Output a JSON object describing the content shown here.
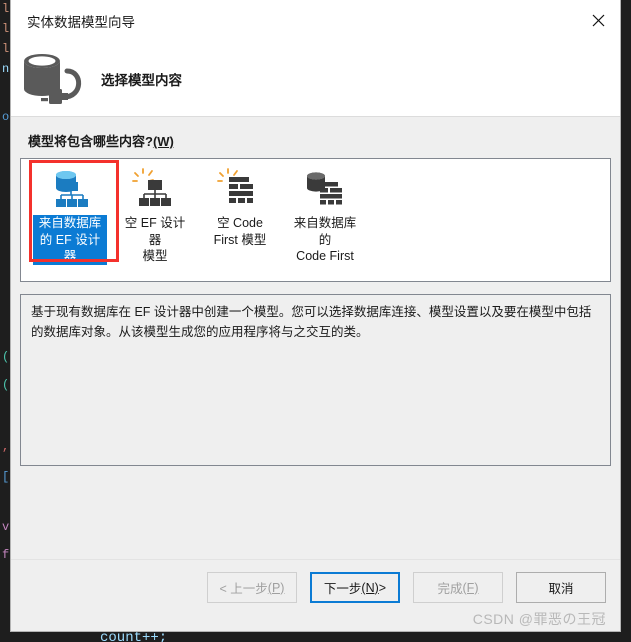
{
  "window": {
    "title": "实体数据模型向导",
    "close_label": "✕"
  },
  "header": {
    "icon": "database-plug-icon",
    "title": "选择模型内容"
  },
  "main": {
    "question": "模型将包含哪些内容?",
    "question_accel": "(W)",
    "models": [
      {
        "label": "来自数据库\n的 EF 设计器",
        "icon": "database-ef-designer-icon",
        "selected": true,
        "annotated": true
      },
      {
        "label": "空 EF 设计器\n模型",
        "icon": "empty-ef-designer-icon",
        "selected": false,
        "annotated": false
      },
      {
        "label": "空 Code\nFirst 模型",
        "icon": "empty-code-first-icon",
        "selected": false,
        "annotated": false
      },
      {
        "label": "来自数据库的\nCode First",
        "icon": "database-code-first-icon",
        "selected": false,
        "annotated": false
      }
    ],
    "description": "基于现有数据库在 EF 设计器中创建一个模型。您可以选择数据库连接、模型设置以及要在模型中包括的数据库对象。从该模型生成您的应用程序将与之交互的类。"
  },
  "footer": {
    "buttons": [
      {
        "label": "< 上一步",
        "accel": "(P)",
        "suffix": "",
        "state": "disabled"
      },
      {
        "label": "下一步",
        "accel": "(N)",
        "suffix": " >",
        "state": "default"
      },
      {
        "label": "完成",
        "accel": "(F)",
        "suffix": "",
        "state": "disabled"
      },
      {
        "label": "取消",
        "accel": "",
        "suffix": "",
        "state": "enabled"
      }
    ],
    "watermark": "CSDN @罪恶の王冠"
  },
  "background": {
    "code_fragment": "count++;",
    "accent_blue": "#0b7bd4",
    "annotation_red": "#f4312c"
  }
}
